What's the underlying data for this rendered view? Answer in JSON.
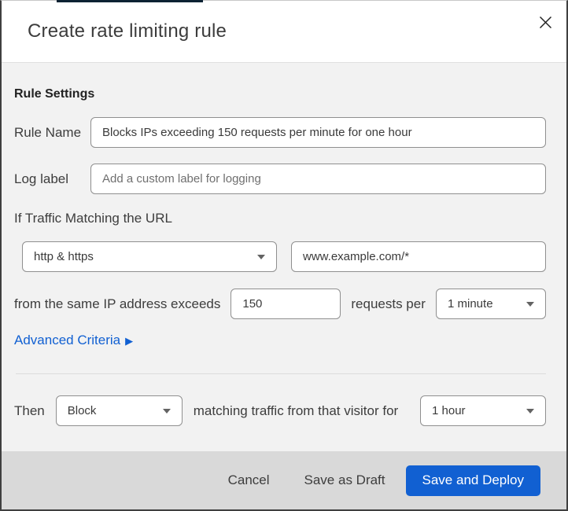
{
  "backdrop": {
    "top_strip_color": "#0d2233"
  },
  "dialog": {
    "title": "Create rate limiting rule",
    "header": {
      "close_icon": "close"
    },
    "body": {
      "section_heading": "Rule Settings",
      "rule_name": {
        "label": "Rule Name",
        "value": "Blocks IPs exceeding 150 requests per minute for one hour"
      },
      "log_label": {
        "label": "Log label",
        "placeholder": "Add a custom label for logging"
      },
      "match": {
        "intro": "If Traffic Matching the URL",
        "scheme": "http & https",
        "url": "www.example.com/*",
        "exceeds_prefix": "from the same IP address exceeds",
        "threshold": "150",
        "exceeds_suffix": "requests per",
        "period": "1 minute",
        "advanced_label": "Advanced Criteria",
        "advanced_arrow": "▶"
      },
      "action": {
        "prefix": "Then",
        "action": "Block",
        "middle": "matching traffic from that visitor for",
        "duration": "1 hour"
      }
    },
    "footer": {
      "cancel_label": "Cancel",
      "save_draft_label": "Save as Draft",
      "save_deploy_label": "Save and Deploy"
    },
    "colors": {
      "accent_blue": "#1160d2",
      "body_bg": "#f2f2f2",
      "footer_bg": "#d9d9d9"
    }
  }
}
